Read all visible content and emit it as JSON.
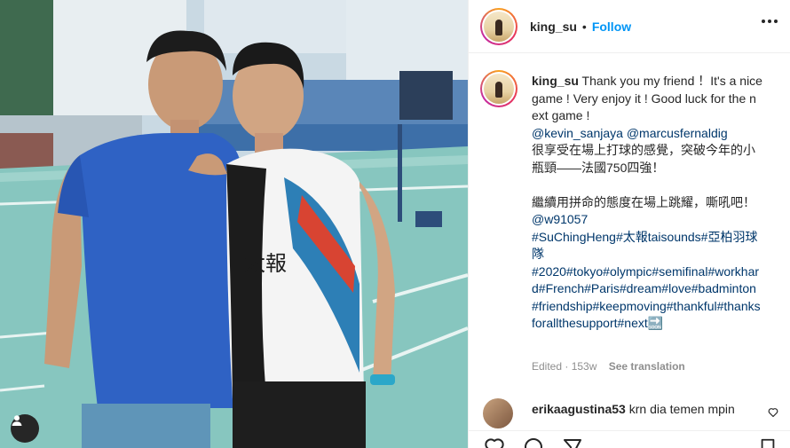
{
  "post": {
    "username": "king_su",
    "follow_label": "Follow",
    "separator": "•",
    "caption_lines": [
      "Thank you my friend  ！It's a nice game ! Very enjoy it ! Good luck for the next game !"
    ],
    "mentions_line": "@kevin_sanjaya @marcusfernaldig",
    "zh_line_1": "很享受在場上打球的感覺，突破今年的小瓶頸——法國750四強！",
    "zh_line_2": "繼續用拼命的態度在場上跳耀，嘶吼吧！",
    "mention_w": "@w91057",
    "tags_1": "#SuChingHeng#太報taisounds#亞柏羽球隊",
    "tags_2": "#2020#tokyo#olympic#semifinal#workhard#French#Paris#dream#love#badminton#friendship#keepmoving#thankful#thanksforallthesupport#next🔜",
    "edited_label": "Edited · 153w",
    "see_translation": "See translation"
  },
  "comment": {
    "username": "erikaagustina53",
    "text": "krn dia temen mpin"
  },
  "icons": {
    "more": "more-horizontal-icon",
    "user_tag": "user-tag-icon",
    "like": "heart-icon",
    "comment": "comment-icon",
    "share": "share-icon",
    "save": "bookmark-icon"
  },
  "colors": {
    "follow": "#0095f6",
    "link": "#00376b",
    "muted": "#8e8e8e"
  }
}
